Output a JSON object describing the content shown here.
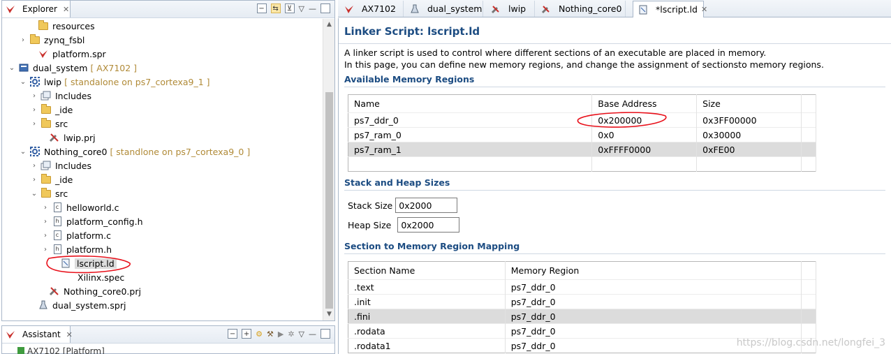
{
  "explorer": {
    "tab_label": "Explorer",
    "close": "✕",
    "items": [
      {
        "twisty": "",
        "icon": "folder-icon",
        "label": "resources",
        "deco": ""
      },
      {
        "twisty": "›",
        "icon": "folder-icon",
        "label": "zynq_fsbl",
        "deco": ""
      },
      {
        "twisty": "",
        "icon": "platform-file-icon",
        "label": "platform.spr",
        "deco": ""
      },
      {
        "twisty": "⌄",
        "icon": "system-project-icon",
        "label": "dual_system",
        "deco": "[ AX7102 ]"
      },
      {
        "twisty": "⌄",
        "icon": "application-project-icon",
        "label": "lwip",
        "deco": "[ standalone on ps7_cortexa9_1 ]"
      },
      {
        "twisty": "›",
        "icon": "includes-icon",
        "label": "Includes",
        "deco": ""
      },
      {
        "twisty": "›",
        "icon": "folder-icon",
        "label": "_ide",
        "deco": ""
      },
      {
        "twisty": "›",
        "icon": "folder-icon",
        "label": "src",
        "deco": ""
      },
      {
        "twisty": "",
        "icon": "prj-file-icon",
        "label": "lwip.prj",
        "deco": ""
      },
      {
        "twisty": "⌄",
        "icon": "application-project-icon",
        "label": "Nothing_core0",
        "deco": "[ standlone on ps7_cortexa9_0 ]"
      },
      {
        "twisty": "›",
        "icon": "includes-icon",
        "label": "Includes",
        "deco": ""
      },
      {
        "twisty": "›",
        "icon": "folder-icon",
        "label": "_ide",
        "deco": ""
      },
      {
        "twisty": "⌄",
        "icon": "folder-icon",
        "label": "src",
        "deco": ""
      },
      {
        "twisty": "›",
        "icon": "c-file-icon",
        "label": "helloworld.c",
        "deco": ""
      },
      {
        "twisty": "›",
        "icon": "h-file-icon",
        "label": "platform_config.h",
        "deco": ""
      },
      {
        "twisty": "›",
        "icon": "c-file-icon",
        "label": "platform.c",
        "deco": ""
      },
      {
        "twisty": "›",
        "icon": "h-file-icon",
        "label": "platform.h",
        "deco": ""
      },
      {
        "twisty": "",
        "icon": "linker-file-icon",
        "label": "lscript.ld",
        "deco": ""
      },
      {
        "twisty": "",
        "icon": "spec-file-icon",
        "label": "Xilinx.spec",
        "deco": ""
      },
      {
        "twisty": "",
        "icon": "prj-file-icon",
        "label": "Nothing_core0.prj",
        "deco": ""
      },
      {
        "twisty": "",
        "icon": "sprj-file-icon",
        "label": "dual_system.sprj",
        "deco": ""
      }
    ]
  },
  "assistant": {
    "tab_label": "Assistant",
    "close": "✕",
    "partial_item": "AX7102 [Platform]"
  },
  "editor_tabs": [
    {
      "label": "AX7102",
      "icon": "platform-tab-icon",
      "close": ""
    },
    {
      "label": "dual_system",
      "icon": "flask-tab-icon",
      "close": ""
    },
    {
      "label": "lwip",
      "icon": "wrench-tab-icon",
      "close": ""
    },
    {
      "label": "Nothing_core0",
      "icon": "wrench-tab-icon",
      "close": ""
    },
    {
      "label": "*lscript.ld",
      "icon": "linker-tab-icon",
      "close": "✕"
    }
  ],
  "editor": {
    "title": "Linker Script: lscript.ld",
    "desc1": "A linker script is used to control where different sections of an executable are placed in memory.",
    "desc2": "In this page, you can define new memory regions, and change the assignment of sectionsto memory regions.",
    "mem_section": "Available Memory Regions",
    "mem_headers": [
      "Name",
      "Base Address",
      "Size"
    ],
    "mem_rows": [
      [
        "ps7_ddr_0",
        "0x200000",
        "0x3FF00000"
      ],
      [
        "ps7_ram_0",
        "0x0",
        "0x30000"
      ],
      [
        "ps7_ram_1",
        "0xFFFF0000",
        "0xFE00"
      ]
    ],
    "stack_section": "Stack and Heap Sizes",
    "stack_label": "Stack Size",
    "stack_value": "0x2000",
    "heap_label": "Heap Size",
    "heap_value": "0x2000",
    "map_section": "Section to Memory Region Mapping",
    "map_headers": [
      "Section Name",
      "Memory Region"
    ],
    "map_rows": [
      [
        ".text",
        "ps7_ddr_0"
      ],
      [
        ".init",
        "ps7_ddr_0"
      ],
      [
        ".fini",
        "ps7_ddr_0"
      ],
      [
        ".rodata",
        "ps7_ddr_0"
      ],
      [
        ".rodata1",
        "ps7_ddr_0"
      ]
    ]
  },
  "watermark": "https://blog.csdn.net/longfei_3",
  "colors": {
    "accent": "#1c4c82",
    "annotation": "#e8101a"
  }
}
